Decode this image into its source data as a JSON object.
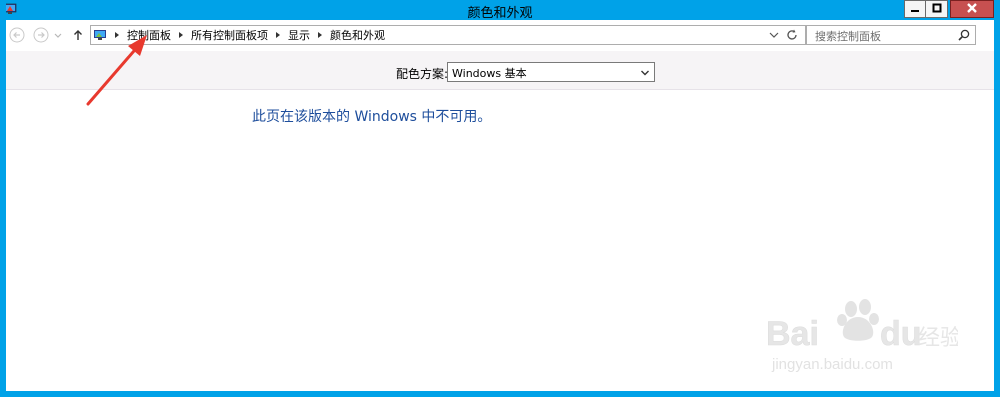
{
  "window": {
    "title": "颜色和外观"
  },
  "titlebar_buttons": {
    "minimize": "minimize-icon",
    "maximize": "maximize-icon",
    "close": "close-icon"
  },
  "nav": {
    "back_icon": "back-arrow-icon",
    "forward_icon": "forward-arrow-icon",
    "recent_icon": "chevron-down-icon",
    "up_icon": "up-arrow-icon"
  },
  "address": {
    "breadcrumbs": [
      "控制面板",
      "所有控制面板项",
      "显示",
      "颜色和外观"
    ],
    "dropdown_icon": "chevron-down-icon",
    "refresh_icon": "refresh-icon"
  },
  "search": {
    "placeholder": "搜索控制面板"
  },
  "scheme": {
    "label": "配色方案:",
    "selected": "Windows 基本"
  },
  "message": "此页在该版本的 Windows 中不可用。",
  "watermark": {
    "brand": "Bai du 经验",
    "url": "jingyan.baidu.com"
  },
  "colors": {
    "titlebar": "#00a2e8",
    "message_text": "#1e4e9c",
    "annotation_arrow": "#e8392e"
  }
}
